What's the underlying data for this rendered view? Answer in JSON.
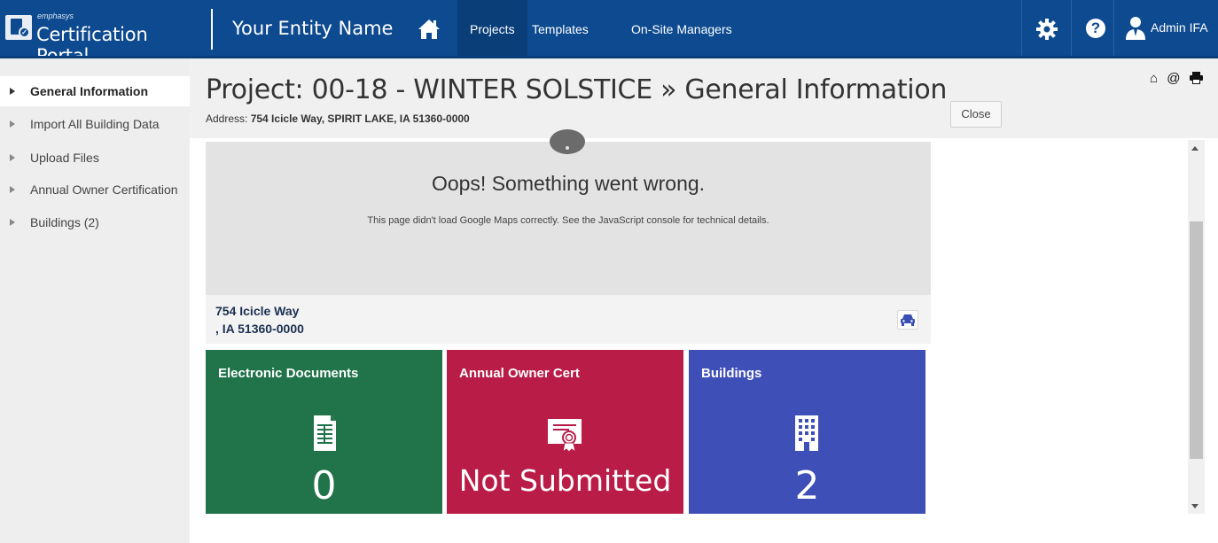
{
  "app": {
    "logo_small": "emphasys",
    "logo_title": "Certification Portal",
    "entity_name": "Your Entity Name",
    "colors": {
      "nav_bg": "#0d4a8f",
      "docs_tile": "#21744a",
      "cert_tile": "#b91c47",
      "bldg_tile": "#3f4fb8"
    }
  },
  "nav": {
    "home_icon": "home-icon",
    "items": [
      {
        "label": "Projects",
        "active": true
      },
      {
        "label": "Templates",
        "active": false
      },
      {
        "label": "On-Site Managers",
        "active": false
      }
    ],
    "settings_icon": "gear-icon",
    "help_icon": "help-icon",
    "user": {
      "icon": "user-tie-icon",
      "name": "Admin IFA"
    }
  },
  "sidebar": {
    "items": [
      {
        "label": "General Information",
        "active": true
      },
      {
        "label": "Import All Building Data",
        "active": false
      },
      {
        "label": "Upload Files",
        "active": false
      },
      {
        "label": "Annual Owner Certification",
        "active": false
      },
      {
        "label": "Buildings (2)",
        "active": false
      }
    ]
  },
  "header": {
    "title": "Project: 00-18 - WINTER SOLSTICE » General Information",
    "address_label": "Address:",
    "address_value": "754 Icicle Way, SPIRIT LAKE, IA 51360-0000",
    "close_label": "Close",
    "icons": [
      "home-outline-icon",
      "at-icon",
      "print-icon"
    ]
  },
  "map": {
    "error_title": "Oops! Something went wrong.",
    "error_detail": "This page didn't load Google Maps correctly. See the JavaScript console for technical details."
  },
  "address_card": {
    "line1": "754 Icicle Way",
    "line2": ", IA 51360-0000",
    "directions_icon": "car-icon"
  },
  "tiles": [
    {
      "title": "Electronic Documents",
      "icon": "document-icon",
      "value": "0"
    },
    {
      "title": "Annual Owner Cert",
      "icon": "certificate-icon",
      "value": "Not Submitted"
    },
    {
      "title": "Buildings",
      "icon": "building-icon",
      "value": "2"
    }
  ]
}
